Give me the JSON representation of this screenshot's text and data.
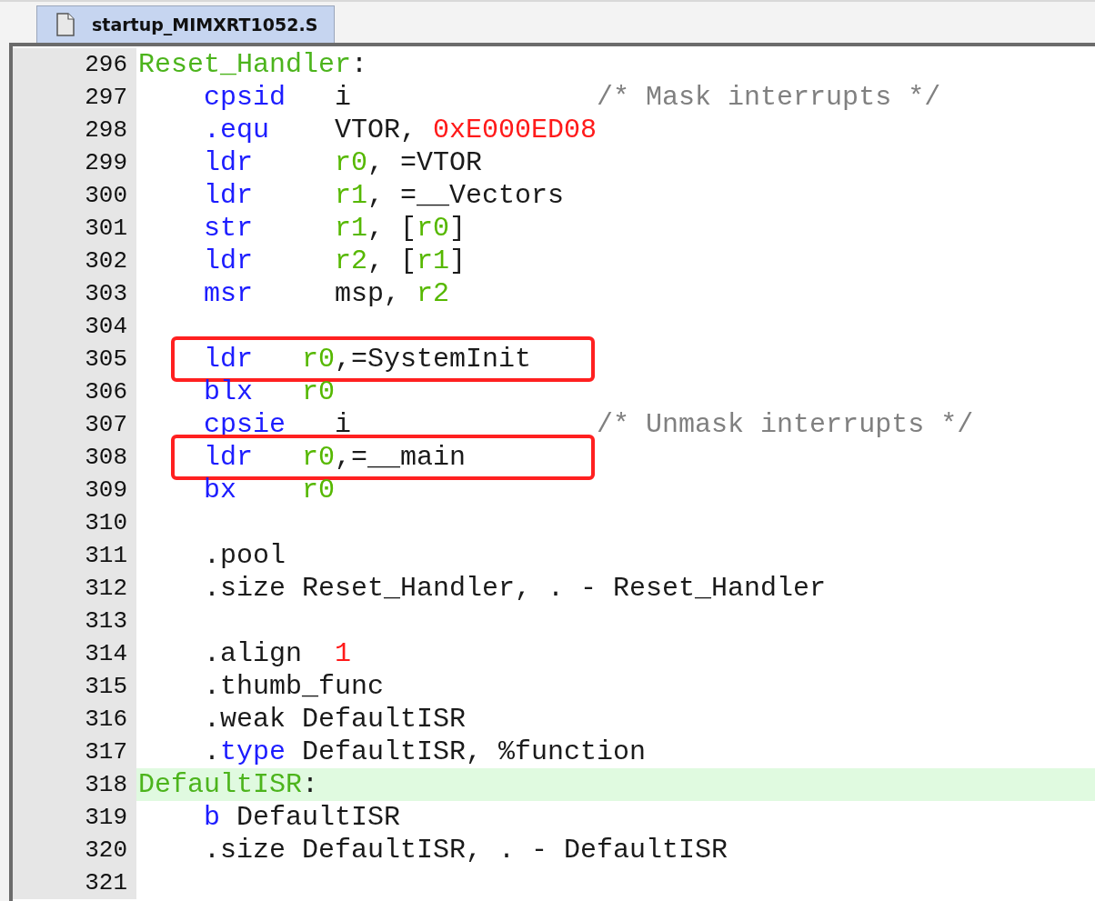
{
  "tab": {
    "title": "startup_MIMXRT1052.S",
    "selected": true
  },
  "lines": [
    {
      "number": "296",
      "current": false,
      "boxed": false,
      "kind": "label",
      "tokens": [
        {
          "kind": "label",
          "text": "Reset_Handler"
        },
        {
          "kind": "plain",
          "text": ":"
        }
      ]
    },
    {
      "number": "297",
      "current": false,
      "boxed": false,
      "kind": "statement",
      "tokens": [
        {
          "kind": "keyword",
          "text": "cpsid"
        },
        {
          "kind": "plain",
          "text": "   i               "
        },
        {
          "kind": "comment",
          "text": "/* Mask interrupts */"
        }
      ]
    },
    {
      "number": "298",
      "current": false,
      "boxed": false,
      "kind": "statement",
      "tokens": [
        {
          "kind": "keyword",
          "text": ".equ"
        },
        {
          "kind": "plain",
          "text": "    VTOR, "
        },
        {
          "kind": "number",
          "text": "0xE000ED08"
        }
      ]
    },
    {
      "number": "299",
      "current": false,
      "boxed": false,
      "kind": "statement",
      "tokens": [
        {
          "kind": "keyword",
          "text": "ldr"
        },
        {
          "kind": "register",
          "text": "     r0"
        },
        {
          "kind": "plain",
          "text": ", =VTOR"
        }
      ]
    },
    {
      "number": "300",
      "current": false,
      "boxed": false,
      "kind": "statement",
      "tokens": [
        {
          "kind": "keyword",
          "text": "ldr"
        },
        {
          "kind": "register",
          "text": "     r1"
        },
        {
          "kind": "plain",
          "text": ", =__Vectors"
        }
      ]
    },
    {
      "number": "301",
      "current": false,
      "boxed": false,
      "kind": "statement",
      "tokens": [
        {
          "kind": "keyword",
          "text": "str"
        },
        {
          "kind": "register",
          "text": "     r1"
        },
        {
          "kind": "plain",
          "text": ", ["
        },
        {
          "kind": "register",
          "text": "r0"
        },
        {
          "kind": "plain",
          "text": "]"
        }
      ]
    },
    {
      "number": "302",
      "current": false,
      "boxed": false,
      "kind": "statement",
      "tokens": [
        {
          "kind": "keyword",
          "text": "ldr"
        },
        {
          "kind": "register",
          "text": "     r2"
        },
        {
          "kind": "plain",
          "text": ", ["
        },
        {
          "kind": "register",
          "text": "r1"
        },
        {
          "kind": "plain",
          "text": "]"
        }
      ]
    },
    {
      "number": "303",
      "current": false,
      "boxed": false,
      "kind": "statement",
      "tokens": [
        {
          "kind": "keyword",
          "text": "msr"
        },
        {
          "kind": "plain",
          "text": "     msp, "
        },
        {
          "kind": "register",
          "text": "r2"
        }
      ]
    },
    {
      "number": "304",
      "current": false,
      "boxed": false
    },
    {
      "number": "305",
      "current": false,
      "boxed": true,
      "kind": "statement",
      "tokens": [
        {
          "kind": "keyword",
          "text": "ldr"
        },
        {
          "kind": "register",
          "text": "   r0"
        },
        {
          "kind": "plain",
          "text": ",=SystemInit"
        }
      ]
    },
    {
      "number": "306",
      "current": false,
      "boxed": false,
      "kind": "statement",
      "tokens": [
        {
          "kind": "keyword",
          "text": "blx"
        },
        {
          "kind": "register",
          "text": "   r0"
        }
      ]
    },
    {
      "number": "307",
      "current": false,
      "boxed": false,
      "kind": "statement",
      "tokens": [
        {
          "kind": "keyword",
          "text": "cpsie"
        },
        {
          "kind": "plain",
          "text": "   i               "
        },
        {
          "kind": "comment",
          "text": "/* Unmask interrupts */"
        }
      ]
    },
    {
      "number": "308",
      "current": false,
      "boxed": true,
      "kind": "statement",
      "tokens": [
        {
          "kind": "keyword",
          "text": "ldr"
        },
        {
          "kind": "register",
          "text": "   r0"
        },
        {
          "kind": "plain",
          "text": ",=__main"
        }
      ]
    },
    {
      "number": "309",
      "current": false,
      "boxed": false,
      "kind": "statement",
      "tokens": [
        {
          "kind": "keyword",
          "text": "bx"
        },
        {
          "kind": "register",
          "text": "    r0"
        }
      ]
    },
    {
      "number": "310",
      "current": false,
      "boxed": false
    },
    {
      "number": "311",
      "current": false,
      "boxed": false,
      "kind": "statement",
      "tokens": [
        {
          "kind": "plain",
          "text": ".pool"
        }
      ]
    },
    {
      "number": "312",
      "current": false,
      "boxed": false,
      "kind": "statement",
      "tokens": [
        {
          "kind": "plain",
          "text": ".size Reset_Handler, . - Reset_Handler"
        }
      ]
    },
    {
      "number": "313",
      "current": false,
      "boxed": false
    },
    {
      "number": "314",
      "current": false,
      "boxed": false,
      "kind": "statement",
      "tokens": [
        {
          "kind": "plain",
          "text": ".align  "
        },
        {
          "kind": "number",
          "text": "1"
        }
      ]
    },
    {
      "number": "315",
      "current": false,
      "boxed": false,
      "kind": "statement",
      "tokens": [
        {
          "kind": "plain",
          "text": ".thumb_func"
        }
      ]
    },
    {
      "number": "316",
      "current": false,
      "boxed": false,
      "kind": "statement",
      "tokens": [
        {
          "kind": "plain",
          "text": ".weak DefaultISR"
        }
      ]
    },
    {
      "number": "317",
      "current": false,
      "boxed": false,
      "kind": "statement",
      "tokens": [
        {
          "kind": "plain",
          "text": "."
        },
        {
          "kind": "keyword",
          "text": "type"
        },
        {
          "kind": "plain",
          "text": " DefaultISR, %function"
        }
      ]
    },
    {
      "number": "318",
      "current": true,
      "boxed": false,
      "kind": "label",
      "tokens": [
        {
          "kind": "label",
          "text": "DefaultISR"
        },
        {
          "kind": "plain",
          "text": ":"
        }
      ]
    },
    {
      "number": "319",
      "current": false,
      "boxed": false,
      "kind": "statement",
      "tokens": [
        {
          "kind": "keyword",
          "text": "b"
        },
        {
          "kind": "plain",
          "text": " DefaultISR"
        }
      ]
    },
    {
      "number": "320",
      "current": false,
      "boxed": false,
      "kind": "statement",
      "tokens": [
        {
          "kind": "plain",
          "text": ".size DefaultISR, . - DefaultISR"
        }
      ]
    },
    {
      "number": "321",
      "current": false,
      "boxed": false
    }
  ]
}
